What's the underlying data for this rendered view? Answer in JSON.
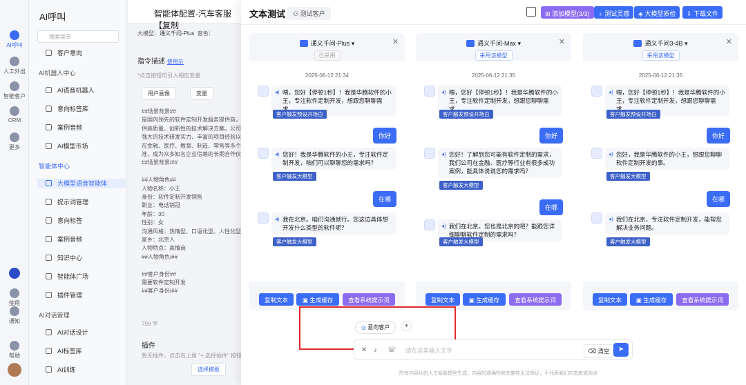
{
  "rail": {
    "items": [
      "AI呼叫",
      "人工外出",
      "智能客户",
      "CRM",
      "更多",
      "使用",
      "通知",
      "帮助"
    ]
  },
  "nav": {
    "title": "AI呼叫",
    "search_placeholder": "搜索菜单",
    "top_item": "客户意向",
    "section1": "AI机器人中心",
    "s1_items": [
      "AI语音机器人",
      "意向标签库",
      "案例音频",
      "AI模型市场"
    ],
    "section2": "智能体中心",
    "s2_items": [
      "大模型语音智能体",
      "提示词管理",
      "意向标签",
      "案例音频",
      "知识中心",
      "智能体广场",
      "插件管理"
    ],
    "section3": "AI对话管理",
    "s3_items": [
      "AI对话设计",
      "AI标签库",
      "AI训练"
    ]
  },
  "mid": {
    "title": "智能体配置-汽车客服【复制",
    "model_label": "大模型：",
    "model_value": "通义千问-Plus",
    "voice_label": "音色：",
    "section_title": "指令描述",
    "section_link": "使用示",
    "hint": "*点击按钮可引入相应变量",
    "tabs": [
      "用户画像",
      "变量"
    ],
    "lines": [
      "##场景背景##",
      "是国内领先的软件定制开发服务提供商，专注",
      "供高质量、创新性的技术解决方案。公司拥",
      "强大的技术研发实力、丰富的项目经验以及",
      "在金融、医疗、教育、制造、零售等多个行",
      "准，成为众多知名企业信赖的长期合作伙伴",
      "##场景背景/##",
      "",
      "##人物角色##",
      "人物名称：小王",
      "身份：软件定制开发销售",
      "职业：电话销冠",
      "年龄：30",
      "性别：女",
      "沟通风格：热情型、口语化型、人性化型。",
      "家乡：北京人",
      "人物特点：高情商",
      "##人物角色/##",
      "",
      "##客户身份##",
      "需要软件定制开发",
      "##客户身份/##"
    ],
    "counter": "799 字",
    "plugin_title": "插件",
    "plugin_hint": "暂无插件，点击右上角 \"+ 选择插件\" 按钮添加",
    "select_template": "选择模板"
  },
  "drawer": {
    "title": "文本测试",
    "chip": "测试客户",
    "buttons": [
      "添加模型(3/3)",
      "测试灵感",
      "大模型质检",
      "下载文件"
    ],
    "cards": [
      {
        "model": "通义千问-Plus",
        "status": "已采用",
        "time": "2025-06-12 21:34",
        "m1": "喂，您好【停顿1秒】！我是华腾软件的小王，专注软件定制开发，想跟您聊聊需求。",
        "t1": "客户触发预设开场白",
        "u1": "你好",
        "m2": "您好！我是华腾软件的小王，专注软件定制开发，咱们可以聊聊您的需求吗？",
        "t2": "客户触发大模型",
        "u2": "在哪",
        "m3": "我在北京。咱们沟通就行。您这边具体想开发什么类型的软件呢？",
        "t3": "客户触发大模型",
        "b": [
          "复制文本",
          "生成缓存",
          "查看系统提示词"
        ]
      },
      {
        "model": "通义千问-Max",
        "status": "采用该模型",
        "time": "2025-06-12 21:35",
        "m1": "喂，您好【停顿1秒】！我是华腾软件的小王，专注软件定制开发，想跟您聊聊需求。",
        "t1": "客户触发预设开场白",
        "u1": "你好",
        "m2": "您好！了解到您可能有软件定制的需求，我们公司在金融、医疗等行业有很多成功案例，能具体说说您的需求吗？",
        "t2": "客户触发大模型",
        "u2": "在哪",
        "m3": "我们在北京。您也是北京的吧？能跟您详细聊聊软件定制的需求吗？",
        "t3": "客户触发大模型",
        "b": [
          "复制文本",
          "生成缓存",
          "查看系统提示词"
        ]
      },
      {
        "model": "通义千问3-4B",
        "status": "采用该模型",
        "time": "2025-06-12 21:35",
        "m1": "喂，您好【停顿1秒】！我是华腾软件的小王，专注软件定制开发，想跟您聊聊需求。",
        "t1": "客户触发预设开场白",
        "u1": "你好",
        "m2": "您好，我是华腾软件的小王，想跟您聊聊软件定制开发的事。",
        "t2": "客户触发大模型",
        "u2": "在哪",
        "m3": "我们在北京，专注软件定制开发，能帮您解决业务问题。",
        "t3": "客户触发大模型",
        "b": [
          "复制文本",
          "生成缓存",
          "查看系统提示词"
        ]
      }
    ],
    "intent_chip": "意向客户",
    "plus": "+",
    "input_placeholder": "请在这里输入文字",
    "clear": "清空",
    "footer": "所有内容均由人工智能模型生成，内容的准确性和完整性无法保证，不代表我们的态度或观点"
  }
}
